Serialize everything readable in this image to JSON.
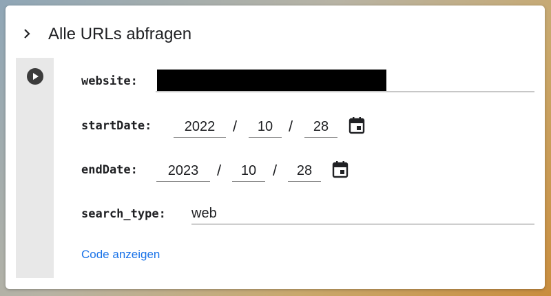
{
  "cell": {
    "title": "Alle URLs abfragen",
    "show_code_label": "Code anzeigen"
  },
  "form": {
    "website": {
      "label": "website:",
      "value": ""
    },
    "start_date": {
      "label": "startDate:",
      "year": "2022",
      "month": "10",
      "day": "28"
    },
    "end_date": {
      "label": "endDate:",
      "year": "2023",
      "month": "10",
      "day": "28"
    },
    "search_type": {
      "label": "search_type:",
      "value": "web"
    },
    "date_separator": "/"
  },
  "icons": [
    "chevron-right-icon",
    "play-icon",
    "calendar-icon"
  ]
}
